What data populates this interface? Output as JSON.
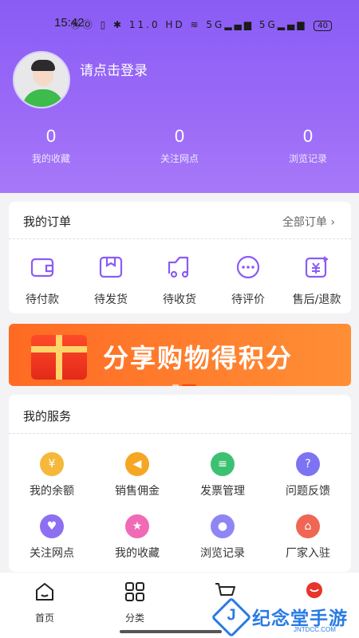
{
  "status_bar": {
    "time": "15:42",
    "icons": "ⓃⓄ ▯ ✱ 11.0 HD ≋ 5G▂▄▆ 5G▂▄▆",
    "battery": "40"
  },
  "profile": {
    "login_prompt": "请点击登录"
  },
  "stats": [
    {
      "value": "0",
      "label": "我的收藏"
    },
    {
      "value": "0",
      "label": "关注网点"
    },
    {
      "value": "0",
      "label": "浏览记录"
    }
  ],
  "orders": {
    "title": "我的订单",
    "all_label": "全部订单 ›",
    "items": [
      {
        "label": "待付款",
        "icon": "wallet-icon"
      },
      {
        "label": "待发货",
        "icon": "package-icon"
      },
      {
        "label": "待收货",
        "icon": "truck-icon"
      },
      {
        "label": "待评价",
        "icon": "comment-icon"
      },
      {
        "label": "售后/退款",
        "icon": "refund-icon"
      }
    ]
  },
  "banner": {
    "text": "分享购物得积分"
  },
  "services": {
    "title": "我的服务",
    "items": [
      {
        "label": "我的余额",
        "icon": "money-bag-icon",
        "color": "#f5b83a"
      },
      {
        "label": "销售佣金",
        "icon": "megaphone-icon",
        "color": "#f5a623"
      },
      {
        "label": "发票管理",
        "icon": "invoice-icon",
        "color": "#3cc173"
      },
      {
        "label": "问题反馈",
        "icon": "question-icon",
        "color": "#7d73f2"
      },
      {
        "label": "关注网点",
        "icon": "heart-icon",
        "color": "#8d6ff3"
      },
      {
        "label": "我的收藏",
        "icon": "star-icon",
        "color": "#f06bb5"
      },
      {
        "label": "浏览记录",
        "icon": "footprint-icon",
        "color": "#8f86f4"
      },
      {
        "label": "厂家入驻",
        "icon": "store-icon",
        "color": "#ef6754"
      }
    ]
  },
  "tabbar": [
    {
      "label": "首页",
      "icon": "home-icon"
    },
    {
      "label": "分类",
      "icon": "grid-icon"
    },
    {
      "label": "",
      "icon": "cart-icon"
    },
    {
      "label": "",
      "icon": "profile-icon"
    }
  ],
  "watermark": {
    "name": "纪念堂手游",
    "sub": "JNTDCC.COM"
  },
  "colors": {
    "accent": "#8a5cf5",
    "icon_purple": "#8a5cf5",
    "banner": "#ff7b2c"
  }
}
